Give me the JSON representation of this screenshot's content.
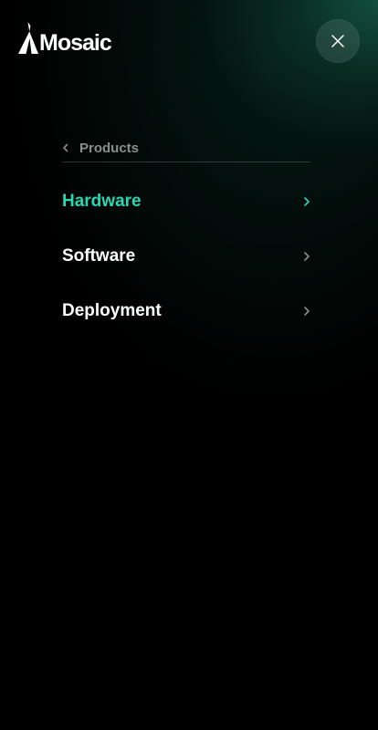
{
  "brand": {
    "name": "Mosaic"
  },
  "header": {
    "close_icon": "close-icon"
  },
  "menu": {
    "back_label": "Products",
    "back_icon": "chevron-left-icon",
    "items": [
      {
        "label": "Hardware",
        "active": true,
        "icon": "chevron-right-icon"
      },
      {
        "label": "Software",
        "active": false,
        "icon": "chevron-right-icon"
      },
      {
        "label": "Deployment",
        "active": false,
        "icon": "chevron-right-icon"
      }
    ]
  },
  "colors": {
    "background": "#000000",
    "accent": "#2ad6b2",
    "muted": "#8a8f8d",
    "text": "#ffffff",
    "glow": "#0c3a2e"
  }
}
